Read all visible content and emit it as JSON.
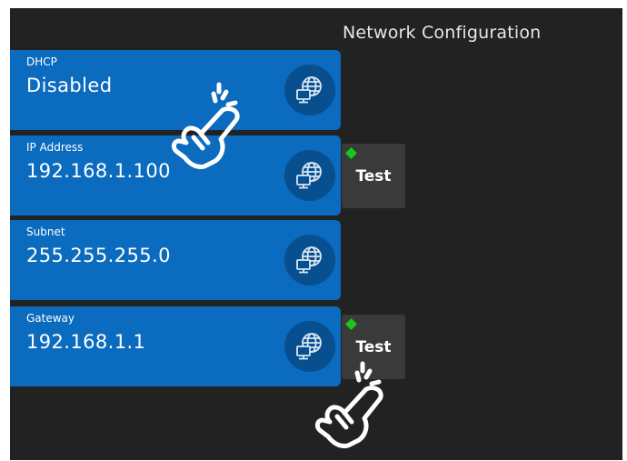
{
  "screen": {
    "title": "Network Configuration"
  },
  "fields": [
    {
      "label": "DHCP",
      "value": "Disabled",
      "icon": "network-globe-icon"
    },
    {
      "label": "IP Address",
      "value": "192.168.1.100",
      "icon": "network-globe-icon"
    },
    {
      "label": "Subnet",
      "value": "255.255.255.0",
      "icon": "network-globe-icon"
    },
    {
      "label": "Gateway",
      "value": "192.168.1.1",
      "icon": "network-globe-icon"
    }
  ],
  "test_buttons": {
    "ip": {
      "label": "Test",
      "status": "ok"
    },
    "gateway": {
      "label": "Test",
      "status": "ok"
    }
  },
  "colors": {
    "background": "#222222",
    "card": "#0a6bbf",
    "card_icon_circle": "#074f8e",
    "test_button": "#3a3a3a",
    "status_ok": "#1ec41e"
  },
  "annotations": [
    "tap-hand-icon",
    "tap-hand-icon"
  ]
}
